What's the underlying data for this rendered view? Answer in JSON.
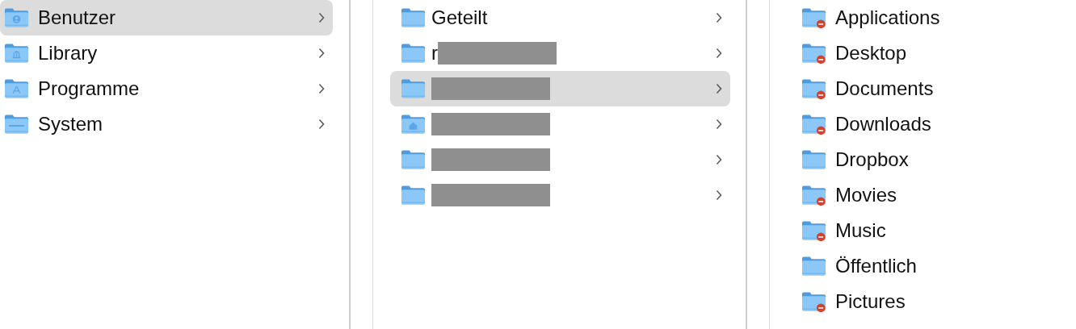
{
  "columns": [
    {
      "items": [
        {
          "name": "Benutzer",
          "kind": "user",
          "selected": true,
          "has_children": true
        },
        {
          "name": "Library",
          "kind": "library",
          "selected": false,
          "has_children": true
        },
        {
          "name": "Programme",
          "kind": "apps",
          "selected": false,
          "has_children": true
        },
        {
          "name": "System",
          "kind": "system",
          "selected": false,
          "has_children": true
        }
      ]
    },
    {
      "items": [
        {
          "name": "Geteilt",
          "kind": "plain",
          "selected": false,
          "has_children": true,
          "redacted": false
        },
        {
          "name": "r",
          "kind": "plain",
          "selected": false,
          "has_children": true,
          "redacted": true
        },
        {
          "kind": "plain",
          "selected": true,
          "has_children": true,
          "redacted": true
        },
        {
          "kind": "home",
          "selected": false,
          "has_children": true,
          "redacted": true
        },
        {
          "kind": "plain",
          "selected": false,
          "has_children": true,
          "redacted": true
        },
        {
          "kind": "plain",
          "selected": false,
          "has_children": true,
          "redacted": true
        }
      ]
    },
    {
      "items": [
        {
          "name": "Applications",
          "kind": "plain",
          "selected": false,
          "restricted": true
        },
        {
          "name": "Desktop",
          "kind": "plain",
          "selected": false,
          "restricted": true
        },
        {
          "name": "Documents",
          "kind": "plain",
          "selected": false,
          "restricted": true
        },
        {
          "name": "Downloads",
          "kind": "plain",
          "selected": false,
          "restricted": true
        },
        {
          "name": "Dropbox",
          "kind": "plain",
          "selected": false,
          "restricted": false
        },
        {
          "name": "Movies",
          "kind": "plain",
          "selected": false,
          "restricted": true
        },
        {
          "name": "Music",
          "kind": "plain",
          "selected": false,
          "restricted": true
        },
        {
          "name": "Öffentlich",
          "kind": "plain",
          "selected": false,
          "restricted": false
        },
        {
          "name": "Pictures",
          "kind": "plain",
          "selected": false,
          "restricted": true
        }
      ]
    }
  ]
}
